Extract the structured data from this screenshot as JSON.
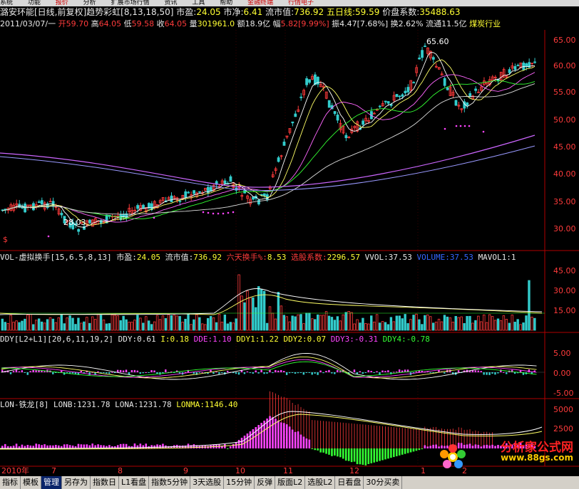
{
  "top_menu": [
    "系统",
    "功能",
    "报价",
    "分析",
    "扩展市场行情",
    "资讯",
    "工具",
    "帮助",
    "金融终端",
    "行情电子"
  ],
  "info": {
    "line1": {
      "stock": "潞安环能[日线,前复权]趋势彩虹[8,13,18,50]",
      "pe_label": "市盈:",
      "pe": "24.05",
      "jz_label": "市净:",
      "jz": "6.41",
      "ltsz_label": "流市值:",
      "ltsz": "736.92",
      "five_label": "五日线:",
      "five": "59.59",
      "jp_label": "价盘系数:",
      "jp": "35488.63"
    },
    "line2": {
      "date": "2011/03/07/一",
      "open_label": "开",
      "open": "59.70",
      "high_label": "高",
      "high": "64.05",
      "low_label": "低",
      "low": "59.58",
      "close_label": "收",
      "close": "64.05",
      "vol_label": "量",
      "vol": "301961.0",
      "amt_label": "额",
      "amt": "18.9亿",
      "amp_label": "幅",
      "amp": "5.82[9.99%]",
      "zf_label": "振",
      "zf": "4.47[7.68%]",
      "hs_label": "换",
      "hs": "2.62%",
      "lt_label": "流通",
      "lt": "11.5亿",
      "industry": "煤炭行业"
    }
  },
  "price_axis": [
    "65.00",
    "60.00",
    "55.00",
    "50.00",
    "45.00",
    "40.00",
    "35.00",
    "30.00"
  ],
  "price_annotations": {
    "high": "65.60",
    "low": "28.03"
  },
  "dollar_mark": "$",
  "vol_panel": {
    "title": "VOL-虚拟换手[15,6.5,8,13]",
    "pe_label": "市盈:",
    "pe": "24.05",
    "ltsz_label": "流市值:",
    "ltsz": "736.92",
    "six_label": "六天换手%:",
    "six": "8.53",
    "xg_label": "选股系数:",
    "xg": "2296.57",
    "vvol_label": "VVOL:",
    "vvol": "37.53",
    "volume_label": "VOLUME:",
    "volume": "37.53",
    "mavol_label": "MAVOL1:",
    "mavol": "1",
    "axis": [
      "45.00",
      "30.00",
      "15.00"
    ]
  },
  "ddy_panel": {
    "title": "DDY[L2+L1][20,6,11,19,2]",
    "ddy_label": "DDY:",
    "ddy": "0.61",
    "i_label": "I:",
    "i": "0.18",
    "ddx_label": "DDE:",
    "ddx": "1.10",
    "ddy1_label": "DDY1:",
    "ddy1": "1.22",
    "ddy2_label": "DDY2:",
    "ddy2": "0.07",
    "ddy3_label": "DDY3:",
    "ddy3": "-0.31",
    "ddy4_label": "DDY4:",
    "ddy4": "-0.78",
    "axis": [
      "5.00",
      "0.00",
      "-5.00"
    ]
  },
  "lon_panel": {
    "title": "LON-铁龙[8]",
    "lonb_label": "LONB:",
    "lonb": "1231.78",
    "lona_label": "LONA:",
    "lona": "1231.78",
    "lonma_label": "LONMA:",
    "lonma": "1146.40",
    "axis": [
      "5000",
      "2500"
    ]
  },
  "date_axis": [
    "2010年",
    "7",
    "8",
    "9",
    "10",
    "11",
    "12",
    "1",
    "2"
  ],
  "bottom_tabs": [
    "指标",
    "模板",
    "管理",
    "另存为",
    "指数日",
    "L1看盘",
    "指数5分钟",
    "3天选股",
    "15分钟",
    "反弹",
    "版面L2",
    "选股L2",
    "日看盘",
    "30分买卖"
  ],
  "active_tab": "管理",
  "watermark": {
    "line1": "分析家公式网",
    "line2": "www.88gs.com"
  },
  "colors": {
    "up": "#ff3b3b",
    "down": "#33cccc",
    "axis": "#b00000"
  }
}
